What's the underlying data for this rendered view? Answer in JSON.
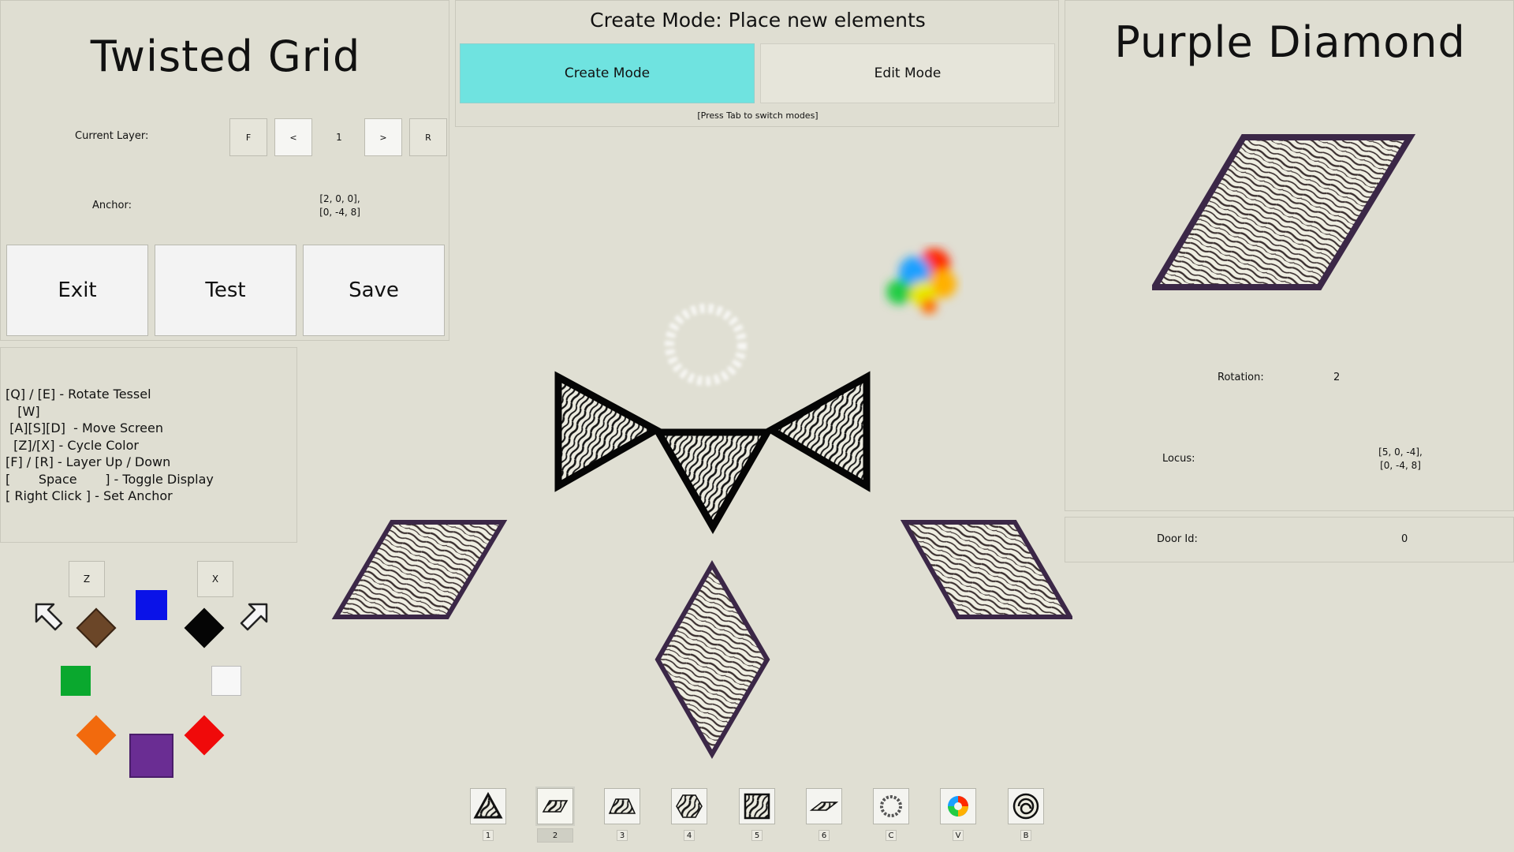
{
  "left_panel": {
    "title": "Twisted Grid",
    "current_layer_label": "Current Layer:",
    "layer_first": "F",
    "layer_prev": "<",
    "layer_value": "1",
    "layer_next": ">",
    "layer_reset": "R",
    "anchor_label": "Anchor:",
    "anchor_line1": "[2, 0, 0],",
    "anchor_line2": "[0, -4, 8]",
    "exit_label": "Exit",
    "test_label": "Test",
    "save_label": "Save"
  },
  "help": {
    "lines": [
      "[Q] / [E] - Rotate Tessel",
      "   [W]",
      " [A][S][D]  - Move Screen",
      "  [Z]/[X] - Cycle Color",
      "[F] / [R] - Layer Up / Down",
      "[       Space       ] - Toggle Display",
      "[ Right Click ] - Set Anchor"
    ]
  },
  "palette": {
    "prev_key": "Z",
    "next_key": "X",
    "colors": {
      "brown": "#6b4628",
      "blue": "#0a12e8",
      "black": "#050505",
      "green": "#0aa82e",
      "white": "#f7f7f7",
      "orange": "#f26a0d",
      "purple": "#6a2d93",
      "red": "#f00a0a"
    }
  },
  "mode": {
    "title": "Create Mode: Place new elements",
    "create_label": "Create Mode",
    "edit_label": "Edit Mode",
    "hint": "[Press Tab to switch modes]",
    "active_color": "#6fe3e0"
  },
  "right_panel": {
    "title": "Purple Diamond",
    "rotation_label": "Rotation:",
    "rotation_value": "2",
    "locus_label": "Locus:",
    "locus_line1": "[5, 0, -4],",
    "locus_line2": "[0, -4, 8]",
    "door_label": "Door Id:",
    "door_value": "0"
  },
  "hotbar": {
    "keys": [
      "1",
      "2",
      "3",
      "4",
      "5",
      "6",
      "C",
      "V",
      "B"
    ],
    "selected_index": 1,
    "icons": [
      "triangle-tile-icon",
      "rhombus-tile-icon",
      "trapezoid-tile-icon",
      "hexagon-tile-icon",
      "square-tile-icon",
      "thin-rhombus-tile-icon",
      "ring-portal-icon",
      "rainbow-orb-icon",
      "spiral-disc-icon"
    ]
  },
  "colors": {
    "tile_border": "#3b2747"
  }
}
